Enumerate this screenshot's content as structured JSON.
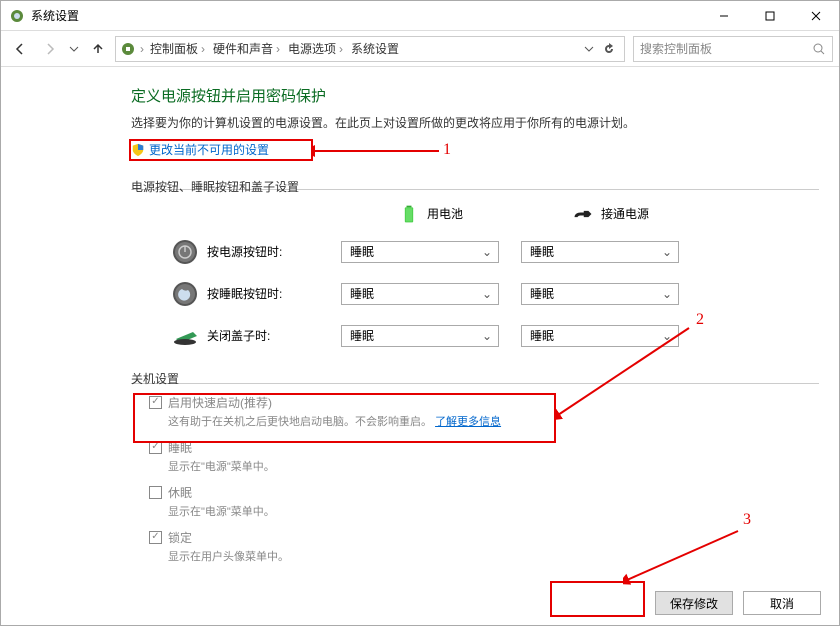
{
  "window": {
    "title": "系统设置"
  },
  "breadcrumbs": [
    "控制面板",
    "硬件和声音",
    "电源选项",
    "系统设置"
  ],
  "search": {
    "placeholder": "搜索控制面板"
  },
  "main": {
    "heading": "定义电源按钮并启用密码保护",
    "subtext": "选择要为你的计算机设置的电源设置。在此页上对设置所做的更改将应用于你所有的电源计划。",
    "change_link": "更改当前不可用的设置",
    "section_buttons": "电源按钮、睡眠按钮和盖子设置",
    "col_battery": "用电池",
    "col_ac": "接通电源",
    "rows": {
      "power_btn": {
        "label": "按电源按钮时:",
        "battery": "睡眠",
        "ac": "睡眠"
      },
      "sleep_btn": {
        "label": "按睡眠按钮时:",
        "battery": "睡眠",
        "ac": "睡眠"
      },
      "lid": {
        "label": "关闭盖子时:",
        "battery": "睡眠",
        "ac": "睡眠"
      }
    },
    "shutdown_section": "关机设置",
    "faststartup": {
      "label": "启用快速启动(推荐)",
      "desc": "这有助于在关机之后更快地启动电脑。不会影响重启。",
      "link": "了解更多信息"
    },
    "sleep": {
      "label": "睡眠",
      "desc": "显示在\"电源\"菜单中。"
    },
    "hibernate": {
      "label": "休眠",
      "desc": "显示在\"电源\"菜单中。"
    },
    "lock": {
      "label": "锁定",
      "desc": "显示在用户头像菜单中。"
    }
  },
  "buttons": {
    "save": "保存修改",
    "cancel": "取消"
  },
  "annotations": {
    "n1": "1",
    "n2": "2",
    "n3": "3"
  }
}
